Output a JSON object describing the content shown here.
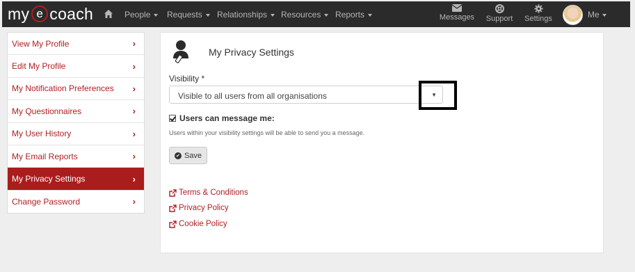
{
  "brand": {
    "my": "my",
    "e": "e",
    "coach": "coach"
  },
  "nav": {
    "home_icon": "home-icon",
    "items": [
      "People",
      "Requests",
      "Relationships",
      "Resources",
      "Reports"
    ],
    "messages": "Messages",
    "support": "Support",
    "settings": "Settings",
    "me": "Me"
  },
  "sidebar": {
    "items": [
      {
        "label": "View My Profile"
      },
      {
        "label": "Edit My Profile"
      },
      {
        "label": "My Notification Preferences"
      },
      {
        "label": "My Questionnaires"
      },
      {
        "label": "My User History"
      },
      {
        "label": "My Email Reports"
      },
      {
        "label": "My Privacy Settings",
        "active": true
      },
      {
        "label": "Change Password"
      }
    ],
    "chevron": "›"
  },
  "main": {
    "title": "My Privacy Settings",
    "visibility_label": "Visibility *",
    "visibility_value": "Visible to all users from all organisations",
    "users_can_message_label": "Users can message me:",
    "users_can_message_checked": true,
    "help_text": "Users within your visibility settings will be able to send you a message.",
    "save_label": "Save",
    "links": [
      "Terms & Conditions",
      "Privacy Policy",
      "Cookie Policy"
    ]
  },
  "colors": {
    "accent": "#b01e22",
    "navbar": "#2b2b2b",
    "active_item": "#aa1d1d"
  }
}
